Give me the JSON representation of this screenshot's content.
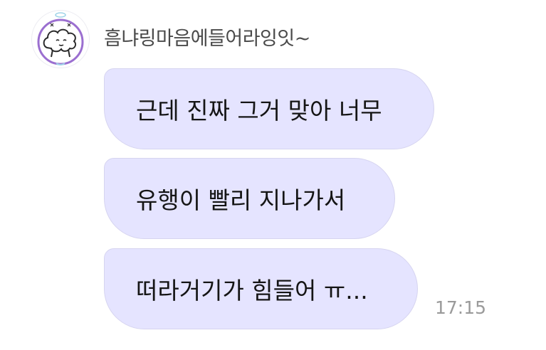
{
  "chat": {
    "sender": {
      "name": "흠냐링마음에들어라잉잇~",
      "avatar_icon": "cloud-doodle-avatar-icon"
    },
    "messages": [
      {
        "text": "근데 진짜 그거 맞아 너무"
      },
      {
        "text": "유행이 빨리 지나가서"
      },
      {
        "text": "떠라거기가 힘들어 ㅠ..."
      }
    ],
    "timestamp": "17:15"
  },
  "colors": {
    "bubble_background": "#e5e4ff",
    "bubble_border": "#d6d4f0",
    "avatar_accent": "#9b6fd0",
    "timestamp_text": "#9a9a9a"
  }
}
